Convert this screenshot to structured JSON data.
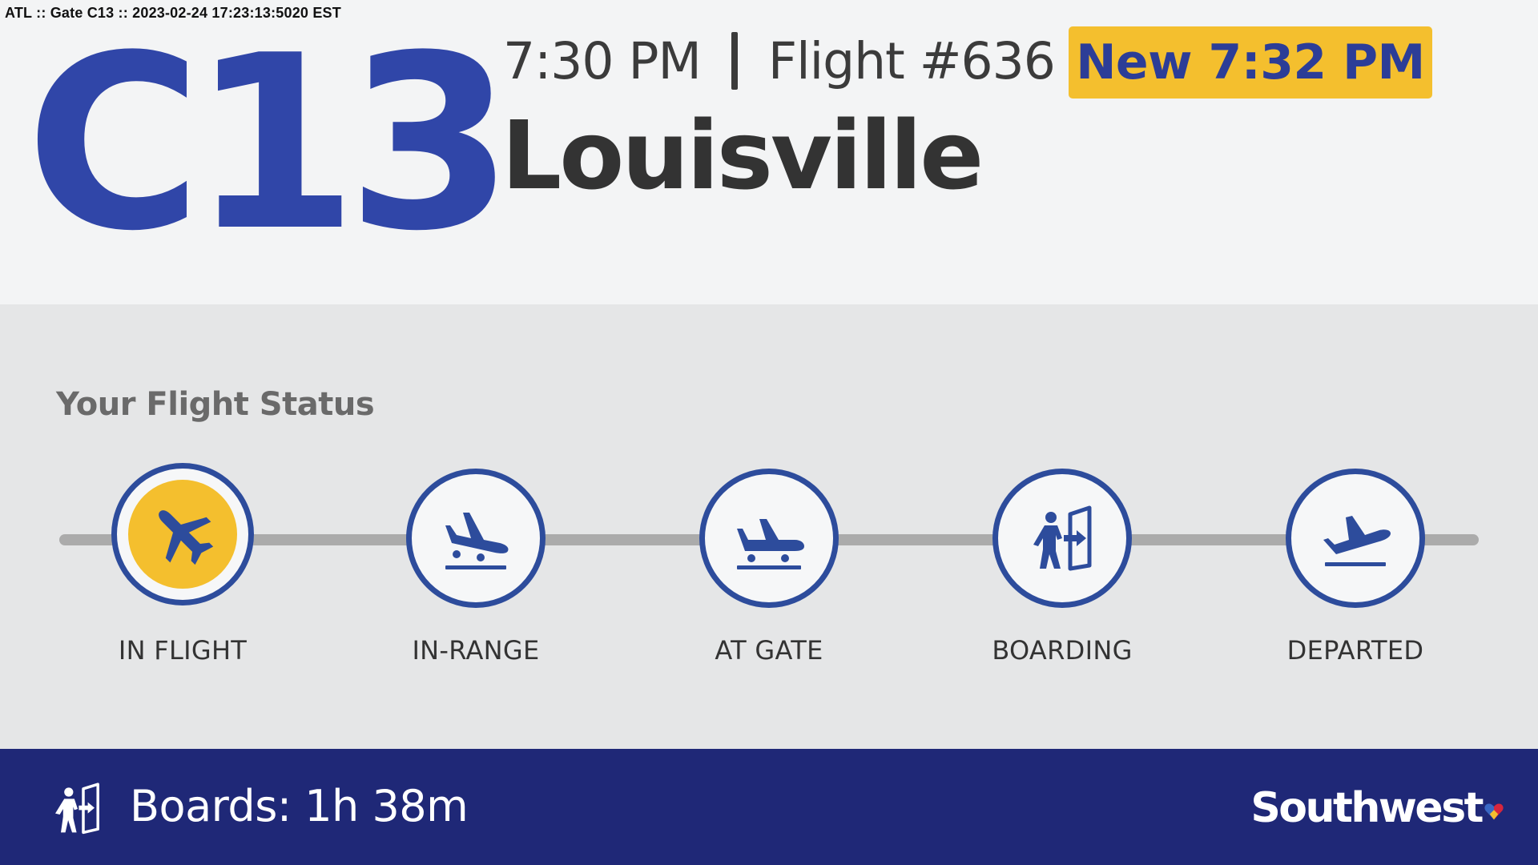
{
  "debug_header": "ATL :: Gate C13 :: 2023-02-24 17:23:13:5020 EST",
  "gate": "C13",
  "flight": {
    "scheduled_time": "7:30 PM",
    "number": "Flight #636",
    "new_time": "New 7:32 PM",
    "destination": "Louisville"
  },
  "status": {
    "title": "Your Flight Status",
    "active_index": 0,
    "steps": [
      {
        "label": "IN FLIGHT",
        "icon": "airplane-icon"
      },
      {
        "label": "IN-RANGE",
        "icon": "landing-icon"
      },
      {
        "label": "AT GATE",
        "icon": "plane-at-gate-icon"
      },
      {
        "label": "BOARDING",
        "icon": "boarding-icon"
      },
      {
        "label": "DEPARTED",
        "icon": "departing-icon"
      }
    ]
  },
  "footer": {
    "boards_text": "Boards: 1h 38m",
    "boards_icon": "boarding-icon",
    "brand": "Southwest",
    "brand_icon": "heart-icon"
  },
  "colors": {
    "gate_blue": "#3046a8",
    "icon_blue": "#2d4c9c",
    "accent_yellow": "#f4bf2e",
    "footer_navy": "#1f2877"
  }
}
